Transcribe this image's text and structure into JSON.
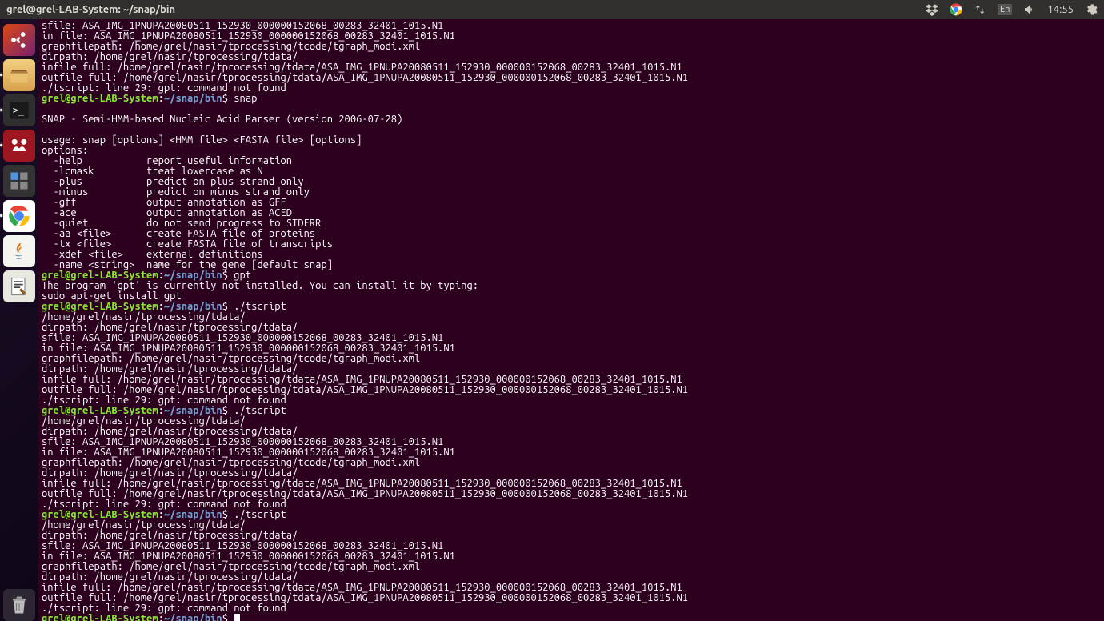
{
  "top_panel": {
    "window_title": "grel@grel-LAB-System: ~/snap/bin",
    "lang": "En",
    "time": "14:55"
  },
  "launcher": {
    "items": [
      {
        "name": "dash-icon"
      },
      {
        "name": "files-icon"
      },
      {
        "name": "terminal-icon"
      },
      {
        "name": "mendeley-icon"
      },
      {
        "name": "workspace-icon"
      },
      {
        "name": "chrome-icon"
      },
      {
        "name": "java-icon"
      },
      {
        "name": "editor-icon"
      }
    ]
  },
  "prompt": {
    "user_host": "grel@grel-LAB-System",
    "colon": ":",
    "path": "~/snap/bin",
    "symbol": "$"
  },
  "terminal_lines": [
    "sfile: ASA_IMG_1PNUPA20080511_152930_000000152068_00283_32401_1015.N1",
    "in file: ASA_IMG_1PNUPA20080511_152930_000000152068_00283_32401_1015.N1",
    "graphfilepath: /home/grel/nasir/tprocessing/tcode/tgraph_modi.xml",
    "dirpath: /home/grel/nasir/tprocessing/tdata/",
    "infile full: /home/grel/nasir/tprocessing/tdata/ASA_IMG_1PNUPA20080511_152930_000000152068_00283_32401_1015.N1",
    "outfile full: /home/grel/nasir/tprocessing/tdata/ASA_IMG_1PNUPA20080511_152930_000000152068_00283_32401_1015.N1",
    "./tscript: line 29: gpt: command not found",
    {
      "type": "prompt",
      "cmd": "snap"
    },
    "",
    "SNAP - Semi-HMM-based Nucleic Acid Parser (version 2006-07-28)",
    "",
    "usage: snap [options] <HMM file> <FASTA file> [options]",
    "options:",
    "  -help           report useful information",
    "  -lcmask         treat lowercase as N",
    "  -plus           predict on plus strand only",
    "  -minus          predict on minus strand only",
    "  -gff            output annotation as GFF",
    "  -ace            output annotation as ACED",
    "  -quiet          do not send progress to STDERR",
    "  -aa <file>      create FASTA file of proteins",
    "  -tx <file>      create FASTA file of transcripts",
    "  -xdef <file>    external definitions",
    "  -name <string>  name for the gene [default snap]",
    {
      "type": "prompt",
      "cmd": "gpt"
    },
    "The program 'gpt' is currently not installed. You can install it by typing:",
    "sudo apt-get install gpt",
    {
      "type": "prompt",
      "cmd": "./tscript"
    },
    "/home/grel/nasir/tprocessing/tdata/",
    "dirpath: /home/grel/nasir/tprocessing/tdata/",
    "sfile: ASA_IMG_1PNUPA20080511_152930_000000152068_00283_32401_1015.N1",
    "in file: ASA_IMG_1PNUPA20080511_152930_000000152068_00283_32401_1015.N1",
    "graphfilepath: /home/grel/nasir/tprocessing/tcode/tgraph_modi.xml",
    "dirpath: /home/grel/nasir/tprocessing/tdata/",
    "infile full: /home/grel/nasir/tprocessing/tdata/ASA_IMG_1PNUPA20080511_152930_000000152068_00283_32401_1015.N1",
    "outfile full: /home/grel/nasir/tprocessing/tdata/ASA_IMG_1PNUPA20080511_152930_000000152068_00283_32401_1015.N1",
    "./tscript: line 29: gpt: command not found",
    {
      "type": "prompt",
      "cmd": "./tscript"
    },
    "/home/grel/nasir/tprocessing/tdata/",
    "dirpath: /home/grel/nasir/tprocessing/tdata/",
    "sfile: ASA_IMG_1PNUPA20080511_152930_000000152068_00283_32401_1015.N1",
    "in file: ASA_IMG_1PNUPA20080511_152930_000000152068_00283_32401_1015.N1",
    "graphfilepath: /home/grel/nasir/tprocessing/tcode/tgraph_modi.xml",
    "dirpath: /home/grel/nasir/tprocessing/tdata/",
    "infile full: /home/grel/nasir/tprocessing/tdata/ASA_IMG_1PNUPA20080511_152930_000000152068_00283_32401_1015.N1",
    "outfile full: /home/grel/nasir/tprocessing/tdata/ASA_IMG_1PNUPA20080511_152930_000000152068_00283_32401_1015.N1",
    "./tscript: line 29: gpt: command not found",
    {
      "type": "prompt",
      "cmd": "./tscript"
    },
    "/home/grel/nasir/tprocessing/tdata/",
    "dirpath: /home/grel/nasir/tprocessing/tdata/",
    "sfile: ASA_IMG_1PNUPA20080511_152930_000000152068_00283_32401_1015.N1",
    "in file: ASA_IMG_1PNUPA20080511_152930_000000152068_00283_32401_1015.N1",
    "graphfilepath: /home/grel/nasir/tprocessing/tcode/tgraph_modi.xml",
    "dirpath: /home/grel/nasir/tprocessing/tdata/",
    "infile full: /home/grel/nasir/tprocessing/tdata/ASA_IMG_1PNUPA20080511_152930_000000152068_00283_32401_1015.N1",
    "outfile full: /home/grel/nasir/tprocessing/tdata/ASA_IMG_1PNUPA20080511_152930_000000152068_00283_32401_1015.N1",
    "./tscript: line 29: gpt: command not found",
    {
      "type": "prompt_cursor"
    }
  ]
}
